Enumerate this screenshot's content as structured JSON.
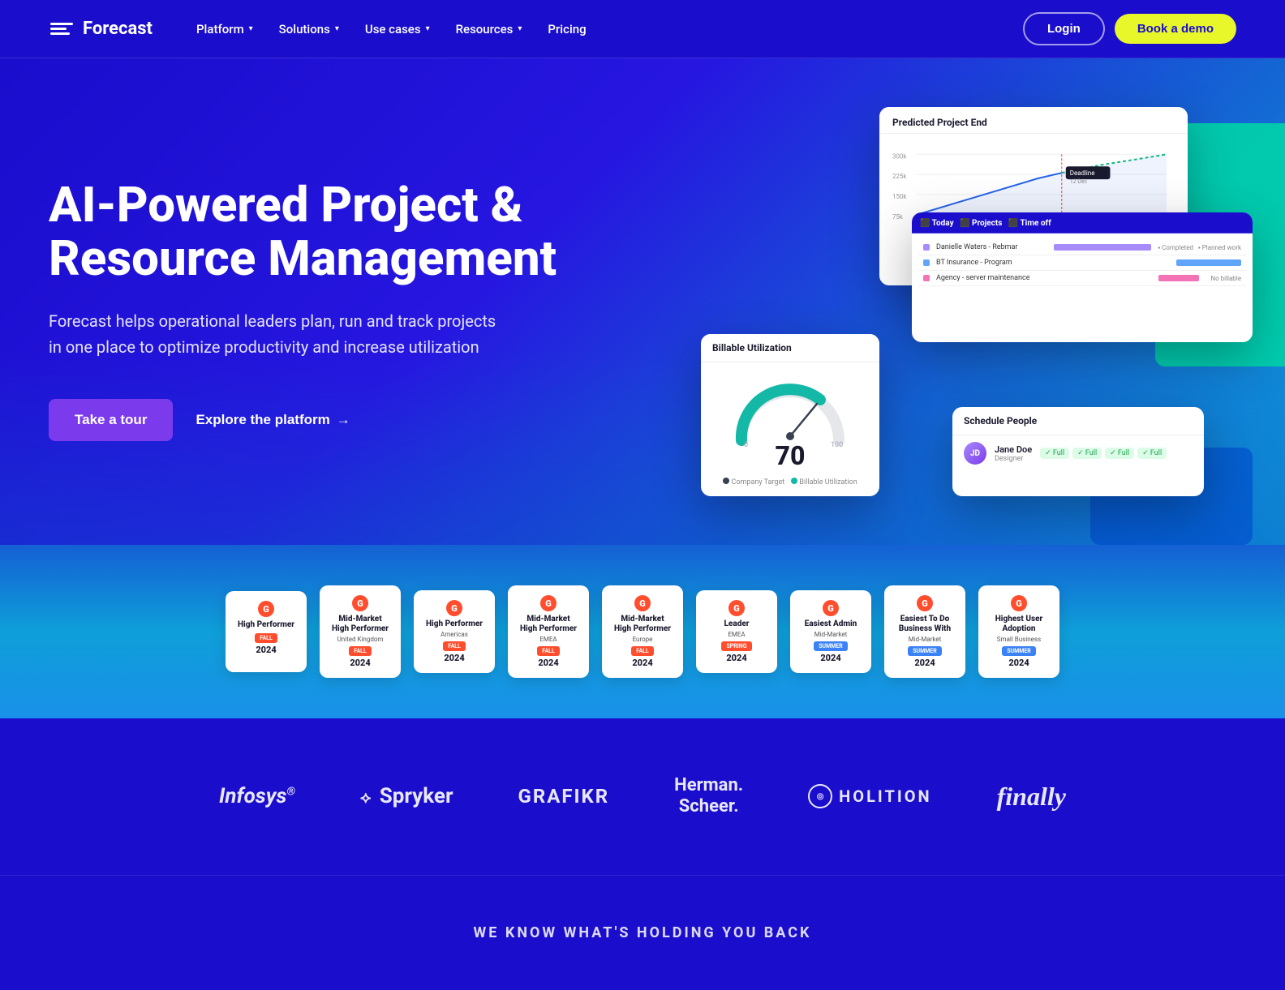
{
  "nav": {
    "logo_text": "Forecast",
    "links": [
      {
        "label": "Platform",
        "has_dropdown": true
      },
      {
        "label": "Solutions",
        "has_dropdown": true
      },
      {
        "label": "Use cases",
        "has_dropdown": true
      },
      {
        "label": "Resources",
        "has_dropdown": true
      },
      {
        "label": "Pricing",
        "has_dropdown": false
      }
    ],
    "login_label": "Login",
    "demo_label": "Book a demo"
  },
  "hero": {
    "title": "AI-Powered Project & Resource Management",
    "subtitle": "Forecast helps operational leaders plan, run and track projects in one place to optimize productivity and increase utilization",
    "cta_primary": "Take a tour",
    "cta_secondary": "Explore the platform"
  },
  "badges": [
    {
      "title": "High Performer",
      "season": "FALL",
      "year": "2024",
      "subtitle": ""
    },
    {
      "title": "Mid-Market High Performer",
      "season": "FALL",
      "year": "2024",
      "subtitle": "United Kingdom"
    },
    {
      "title": "High Performer",
      "season": "FALL",
      "year": "2024",
      "subtitle": "Americas"
    },
    {
      "title": "Mid-Market High Performer",
      "season": "FALL",
      "year": "2024",
      "subtitle": "EMEA"
    },
    {
      "title": "Mid-Market High Performer",
      "season": "FALL",
      "year": "2024",
      "subtitle": "Europe"
    },
    {
      "title": "Leader",
      "season": "SPRING",
      "year": "2024",
      "subtitle": "EMEA"
    },
    {
      "title": "Easiest Admin",
      "season": "SUMMER",
      "year": "2024",
      "subtitle": "Mid-Market"
    },
    {
      "title": "Easiest To Do Business With",
      "season": "SUMMER",
      "year": "2024",
      "subtitle": "Mid-Market"
    },
    {
      "title": "Highest User Adoption",
      "season": "SUMMER",
      "year": "2024",
      "subtitle": "Small Business"
    }
  ],
  "clients": [
    {
      "name": "Infosys",
      "style": "infosys"
    },
    {
      "name": "Spryker",
      "style": "spryker"
    },
    {
      "name": "GRAFIKR",
      "style": "grafikr"
    },
    {
      "name": "Herman. Scheer.",
      "style": "herman"
    },
    {
      "name": "HOLITION",
      "style": "holition"
    },
    {
      "name": "finally",
      "style": "finally"
    }
  ],
  "bottom_cta": {
    "text": "WE KNOW WHAT'S HOLDING YOU BACK"
  },
  "chart": {
    "title": "Predicted Project End",
    "gauge_value": "70",
    "gauge_label": "Billable Utilization"
  }
}
